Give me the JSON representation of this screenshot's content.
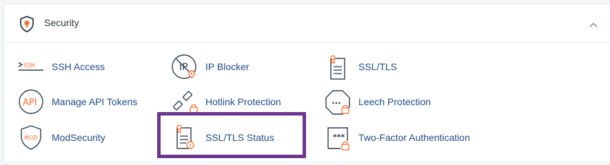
{
  "section": {
    "title": "Security",
    "icon": "shield-icon",
    "collapse_icon": "chevron-up-icon"
  },
  "items": [
    {
      "label": "SSH Access",
      "icon": "ssh-terminal-icon"
    },
    {
      "label": "IP Blocker",
      "icon": "ip-blocker-icon"
    },
    {
      "label": "SSL/TLS",
      "icon": "certificate-icon"
    },
    {
      "label": "Manage API Tokens",
      "icon": "api-icon"
    },
    {
      "label": "Hotlink Protection",
      "icon": "broken-link-lock-icon"
    },
    {
      "label": "Leech Protection",
      "icon": "octagon-lock-icon"
    },
    {
      "label": "ModSecurity",
      "icon": "mod-shield-icon"
    },
    {
      "label": "SSL/TLS Status",
      "icon": "certificate-status-icon"
    },
    {
      "label": "Two-Factor Authentication",
      "icon": "password-lock-icon"
    }
  ],
  "icon_badges": {
    "ssh_text": "SSH",
    "ip_text": "IP",
    "api_text": "API",
    "mod_text": "MOD",
    "leech_dots": "...",
    "twofa_stars": "***"
  },
  "colors": {
    "brand_orange": "#ff6c2c",
    "icon_dark": "#293a4a",
    "link_blue": "#1f4b87",
    "highlight_purple": "#6b3590"
  }
}
